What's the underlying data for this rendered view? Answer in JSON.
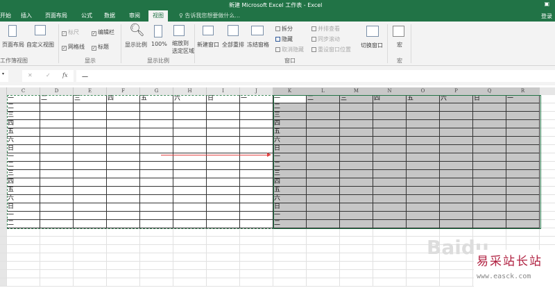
{
  "title": "新建 Microsoft Excel 工作表 - Excel",
  "tabs": [
    "开始",
    "插入",
    "页面布局",
    "公式",
    "数据",
    "审阅",
    "视图"
  ],
  "active_tab": "视图",
  "tell_me": "告诉我您想要做什么...",
  "login": "登录",
  "ribbon": {
    "workbook_views": {
      "items": [
        "页面布局",
        "自定义视图"
      ],
      "group": "工作簿视图"
    },
    "show": {
      "ruler": "标尺",
      "formula_bar": "编辑栏",
      "gridlines": "网格线",
      "headings": "标题",
      "group": "显示"
    },
    "zoom": {
      "items": [
        "显示比例",
        "100%",
        "缩放到",
        "选定区域"
      ],
      "group": "显示比例"
    },
    "window": {
      "items": [
        "新建窗口",
        "全部重排",
        "冻结窗格",
        "拆分",
        "隐藏",
        "取消隐藏",
        "并排查看",
        "同步滚动",
        "重设窗口位置",
        "切换窗口"
      ],
      "group": "窗口"
    },
    "macros": {
      "label": "宏",
      "group": "宏"
    }
  },
  "formula_bar": {
    "value": "一",
    "cancel": "✕",
    "enter": "✓",
    "fx": "fx"
  },
  "columns": [
    "C",
    "D",
    "E",
    "F",
    "G",
    "H",
    "I",
    "J",
    "K",
    "L",
    "M",
    "N",
    "O",
    "P",
    "Q",
    "R"
  ],
  "header_row": [
    "一",
    "二",
    "三",
    "四",
    "五",
    "六",
    "日",
    "一"
  ],
  "first_col": [
    "一",
    "二",
    "三",
    "四",
    "五",
    "六",
    "日",
    "一",
    "二",
    "三",
    "四",
    "五",
    "六",
    "日",
    "一",
    "二"
  ],
  "watermark": {
    "baidu": "Baidu",
    "site": "易采站长站",
    "url": "www.easck.com"
  },
  "colors": {
    "accent": "#217346",
    "selection": "#c6c6c6"
  }
}
